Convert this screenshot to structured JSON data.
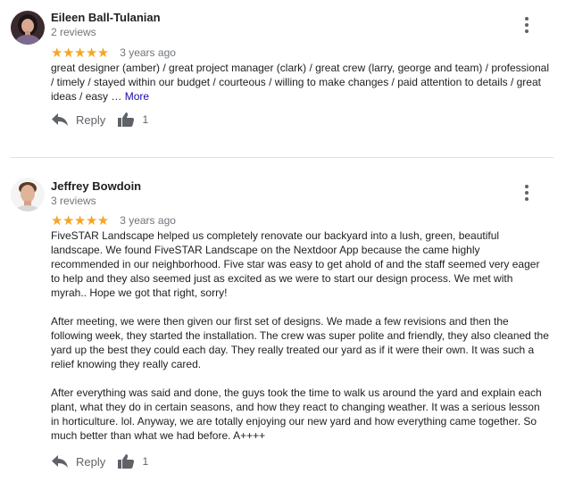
{
  "reviews": [
    {
      "name": "Eileen Ball-Tulanian",
      "review_count": "2 reviews",
      "stars": "★★★★★",
      "time": "3 years ago",
      "text": "great designer (amber) / great project manager (clark) / great crew (larry, george and team) / professional / timely / stayed within our budget / courteous / willing to make changes / paid attention to details / great ideas / easy … ",
      "more_label": "More",
      "reply_label": "Reply",
      "likes": "1"
    },
    {
      "name": "Jeffrey Bowdoin",
      "review_count": "3 reviews",
      "stars": "★★★★★",
      "time": "3 years ago",
      "paragraphs": [
        "FiveSTAR Landscape helped us completely renovate our backyard into a lush, green, beautiful landscape. We found FiveSTAR Landscape on the Nextdoor App because the came highly recommended in our neighborhood. Five star was easy to get ahold of and the staff seemed very eager to help and they also seemed just as excited as we were to start our design process. We met with myrah.. Hope we got that right, sorry!",
        "After meeting, we were then given our first set of designs. We made a few revisions and then the following week, they started the installation. The crew was super polite and friendly, they also cleaned the yard up the best they could each day. They really treated our yard as if it were their own. It was such a relief knowing they really cared.",
        "After everything was said and done, the guys took the time to walk us around the yard and explain each plant, what they do in certain seasons, and how they react to changing weather. It was a serious lesson in horticulture. lol. Anyway, we are totally enjoying our new yard and how everything came together. So much better than what we had before. A++++"
      ],
      "reply_label": "Reply",
      "likes": "1"
    }
  ],
  "colors": {
    "star": "#f6a623",
    "link": "#1a0dab",
    "secondary_text": "#70757a",
    "icon": "#5f6368",
    "divider": "#e0e0e0"
  }
}
